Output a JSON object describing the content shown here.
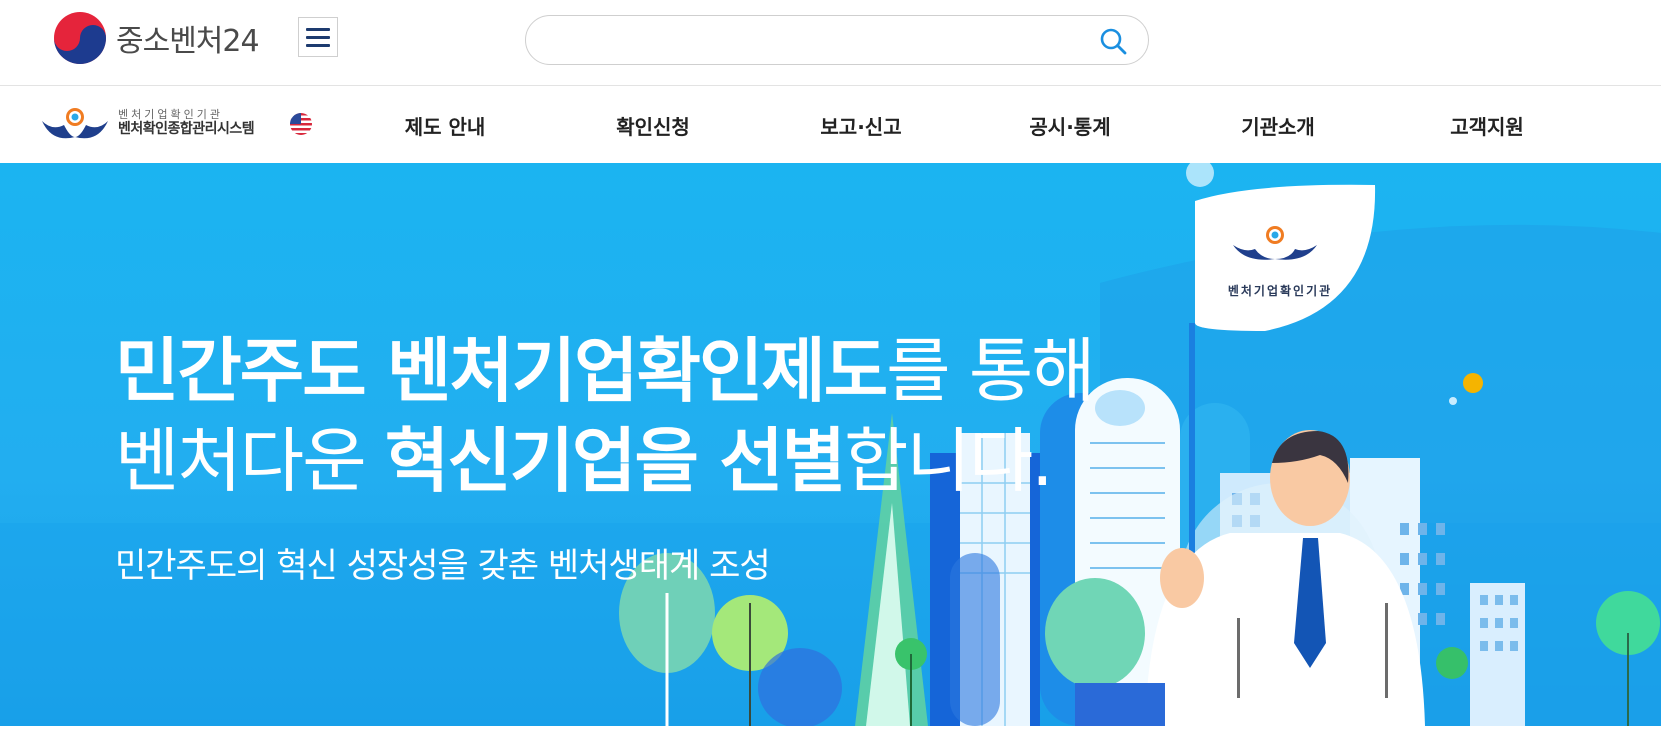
{
  "header": {
    "brand_name": "중소벤처24",
    "menu_icon": "hamburger-icon",
    "search": {
      "placeholder": "",
      "icon": "search-icon"
    }
  },
  "nav": {
    "system_logo_small": "벤처기업확인기관",
    "system_logo_big": "벤처확인종합관리시스템",
    "language_icon": "us-flag-icon",
    "items": [
      "제도 안내",
      "확인신청",
      "보고·신고",
      "공시·통계",
      "기관소개",
      "고객지원"
    ]
  },
  "hero": {
    "line1_bold": "민간주도 벤처기업확인제도",
    "line1_rest": "를 통해",
    "line2_start": "벤처다운 ",
    "line2_bold": "혁신기업을 선별",
    "line2_rest": "합니다.",
    "subtitle": "민간주도의 혁신 성장성을 갖춘 벤처생태계 조성",
    "sign_text": "벤처기업확인기관"
  },
  "colors": {
    "hero_bg": "#1bb4f1",
    "nav_text": "#222222",
    "brand_navy": "#1d3b6f",
    "search_icon": "#1a8fe0"
  }
}
